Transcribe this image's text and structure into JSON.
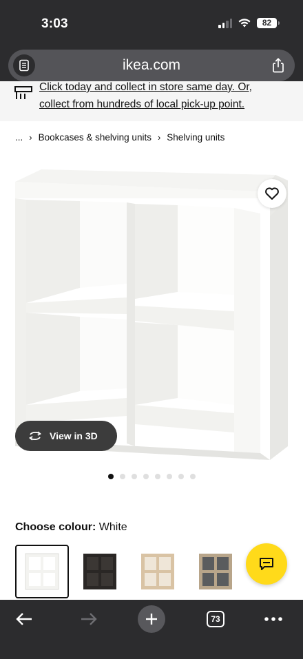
{
  "status_bar": {
    "time": "3:03",
    "battery": "82"
  },
  "browser": {
    "url": "ikea.com",
    "open_tabs": "73"
  },
  "banner": {
    "line1": "Click today and collect in store same day. Or,",
    "line2": "collect from hundreds of local pick-up point."
  },
  "breadcrumb": {
    "ellipsis": "...",
    "items": [
      "Bookcases & shelving units",
      "Shelving units"
    ]
  },
  "gallery": {
    "view_3d_label": "View in 3D",
    "image_count": 8,
    "active_index": 0
  },
  "colour": {
    "label": "Choose colour:",
    "value": "White",
    "swatches": [
      "White",
      "Black-brown",
      "White stained oak effect",
      "Grey/wood effect"
    ]
  },
  "colors": {
    "chrome": "#2c2c2e",
    "chat_accent": "#ffda1a"
  }
}
